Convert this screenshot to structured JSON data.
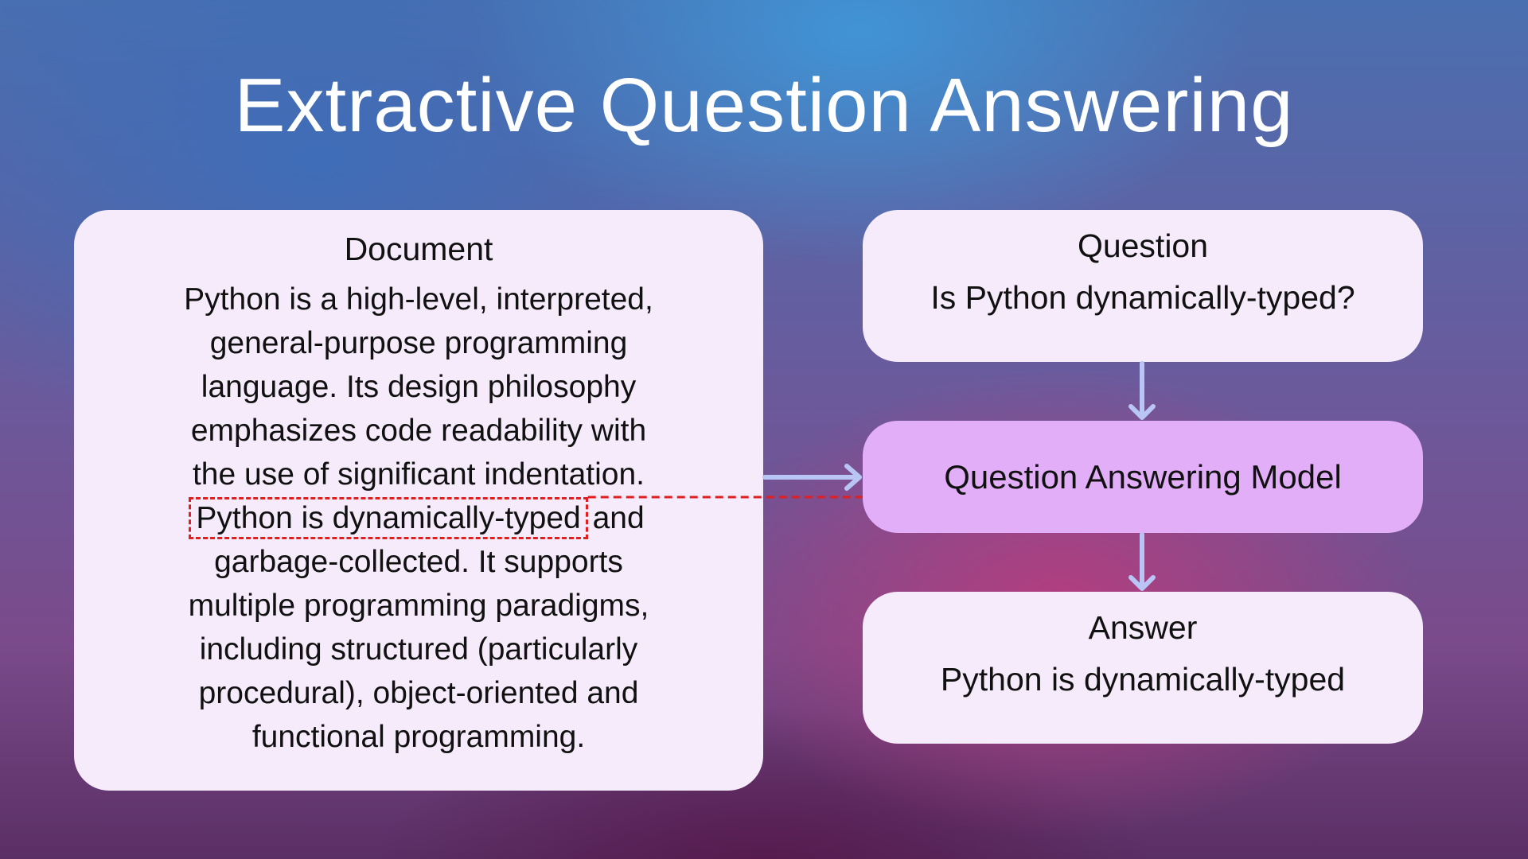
{
  "title": "Extractive Question Answering",
  "document": {
    "heading": "Document",
    "lines_before": [
      "Python is a high-level, interpreted,",
      "general-purpose programming",
      "language. Its design philosophy",
      "emphasizes code readability with",
      "the use of significant indentation."
    ],
    "highlight": "Python is dynamically-typed",
    "highlight_rest": " and",
    "lines_after": [
      "garbage-collected. It supports",
      "multiple programming paradigms,",
      "including structured (particularly",
      "procedural), object-oriented and",
      "functional programming."
    ]
  },
  "question": {
    "heading": "Question",
    "text": "Is Python dynamically-typed?"
  },
  "model": {
    "label": "Question Answering Model"
  },
  "answer": {
    "heading": "Answer",
    "text": "Python is dynamically-typed"
  },
  "colors": {
    "arrow": "#b9c6f5",
    "highlight": "#e02020",
    "box": "#f6ebfb",
    "model": "#e2aef8"
  }
}
